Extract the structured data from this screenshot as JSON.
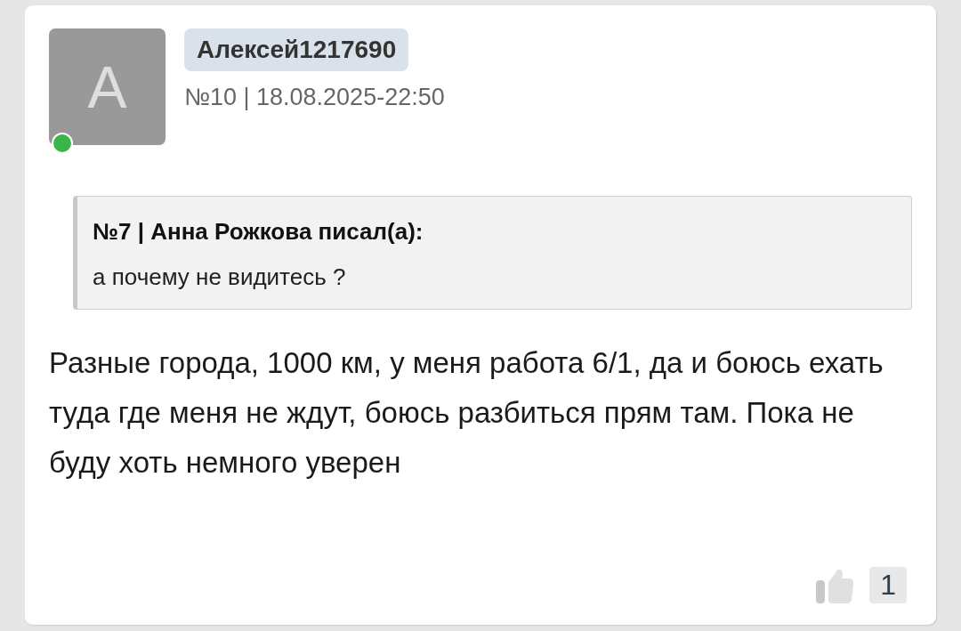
{
  "post": {
    "avatar_letter": "A",
    "online": true,
    "username": "Алексей1217690",
    "meta": "№10 | 18.08.2025-22:50",
    "quote": {
      "title": "№7 | Анна Рожкова писал(а):",
      "text": "а почему не видитесь ?"
    },
    "body": "Разные города, 1000 км, у меня работа 6/1, да и боюсь ехать туда где меня не ждут, боюсь разбиться прям там. Пока не буду хоть немного уверен",
    "likes": "1"
  }
}
